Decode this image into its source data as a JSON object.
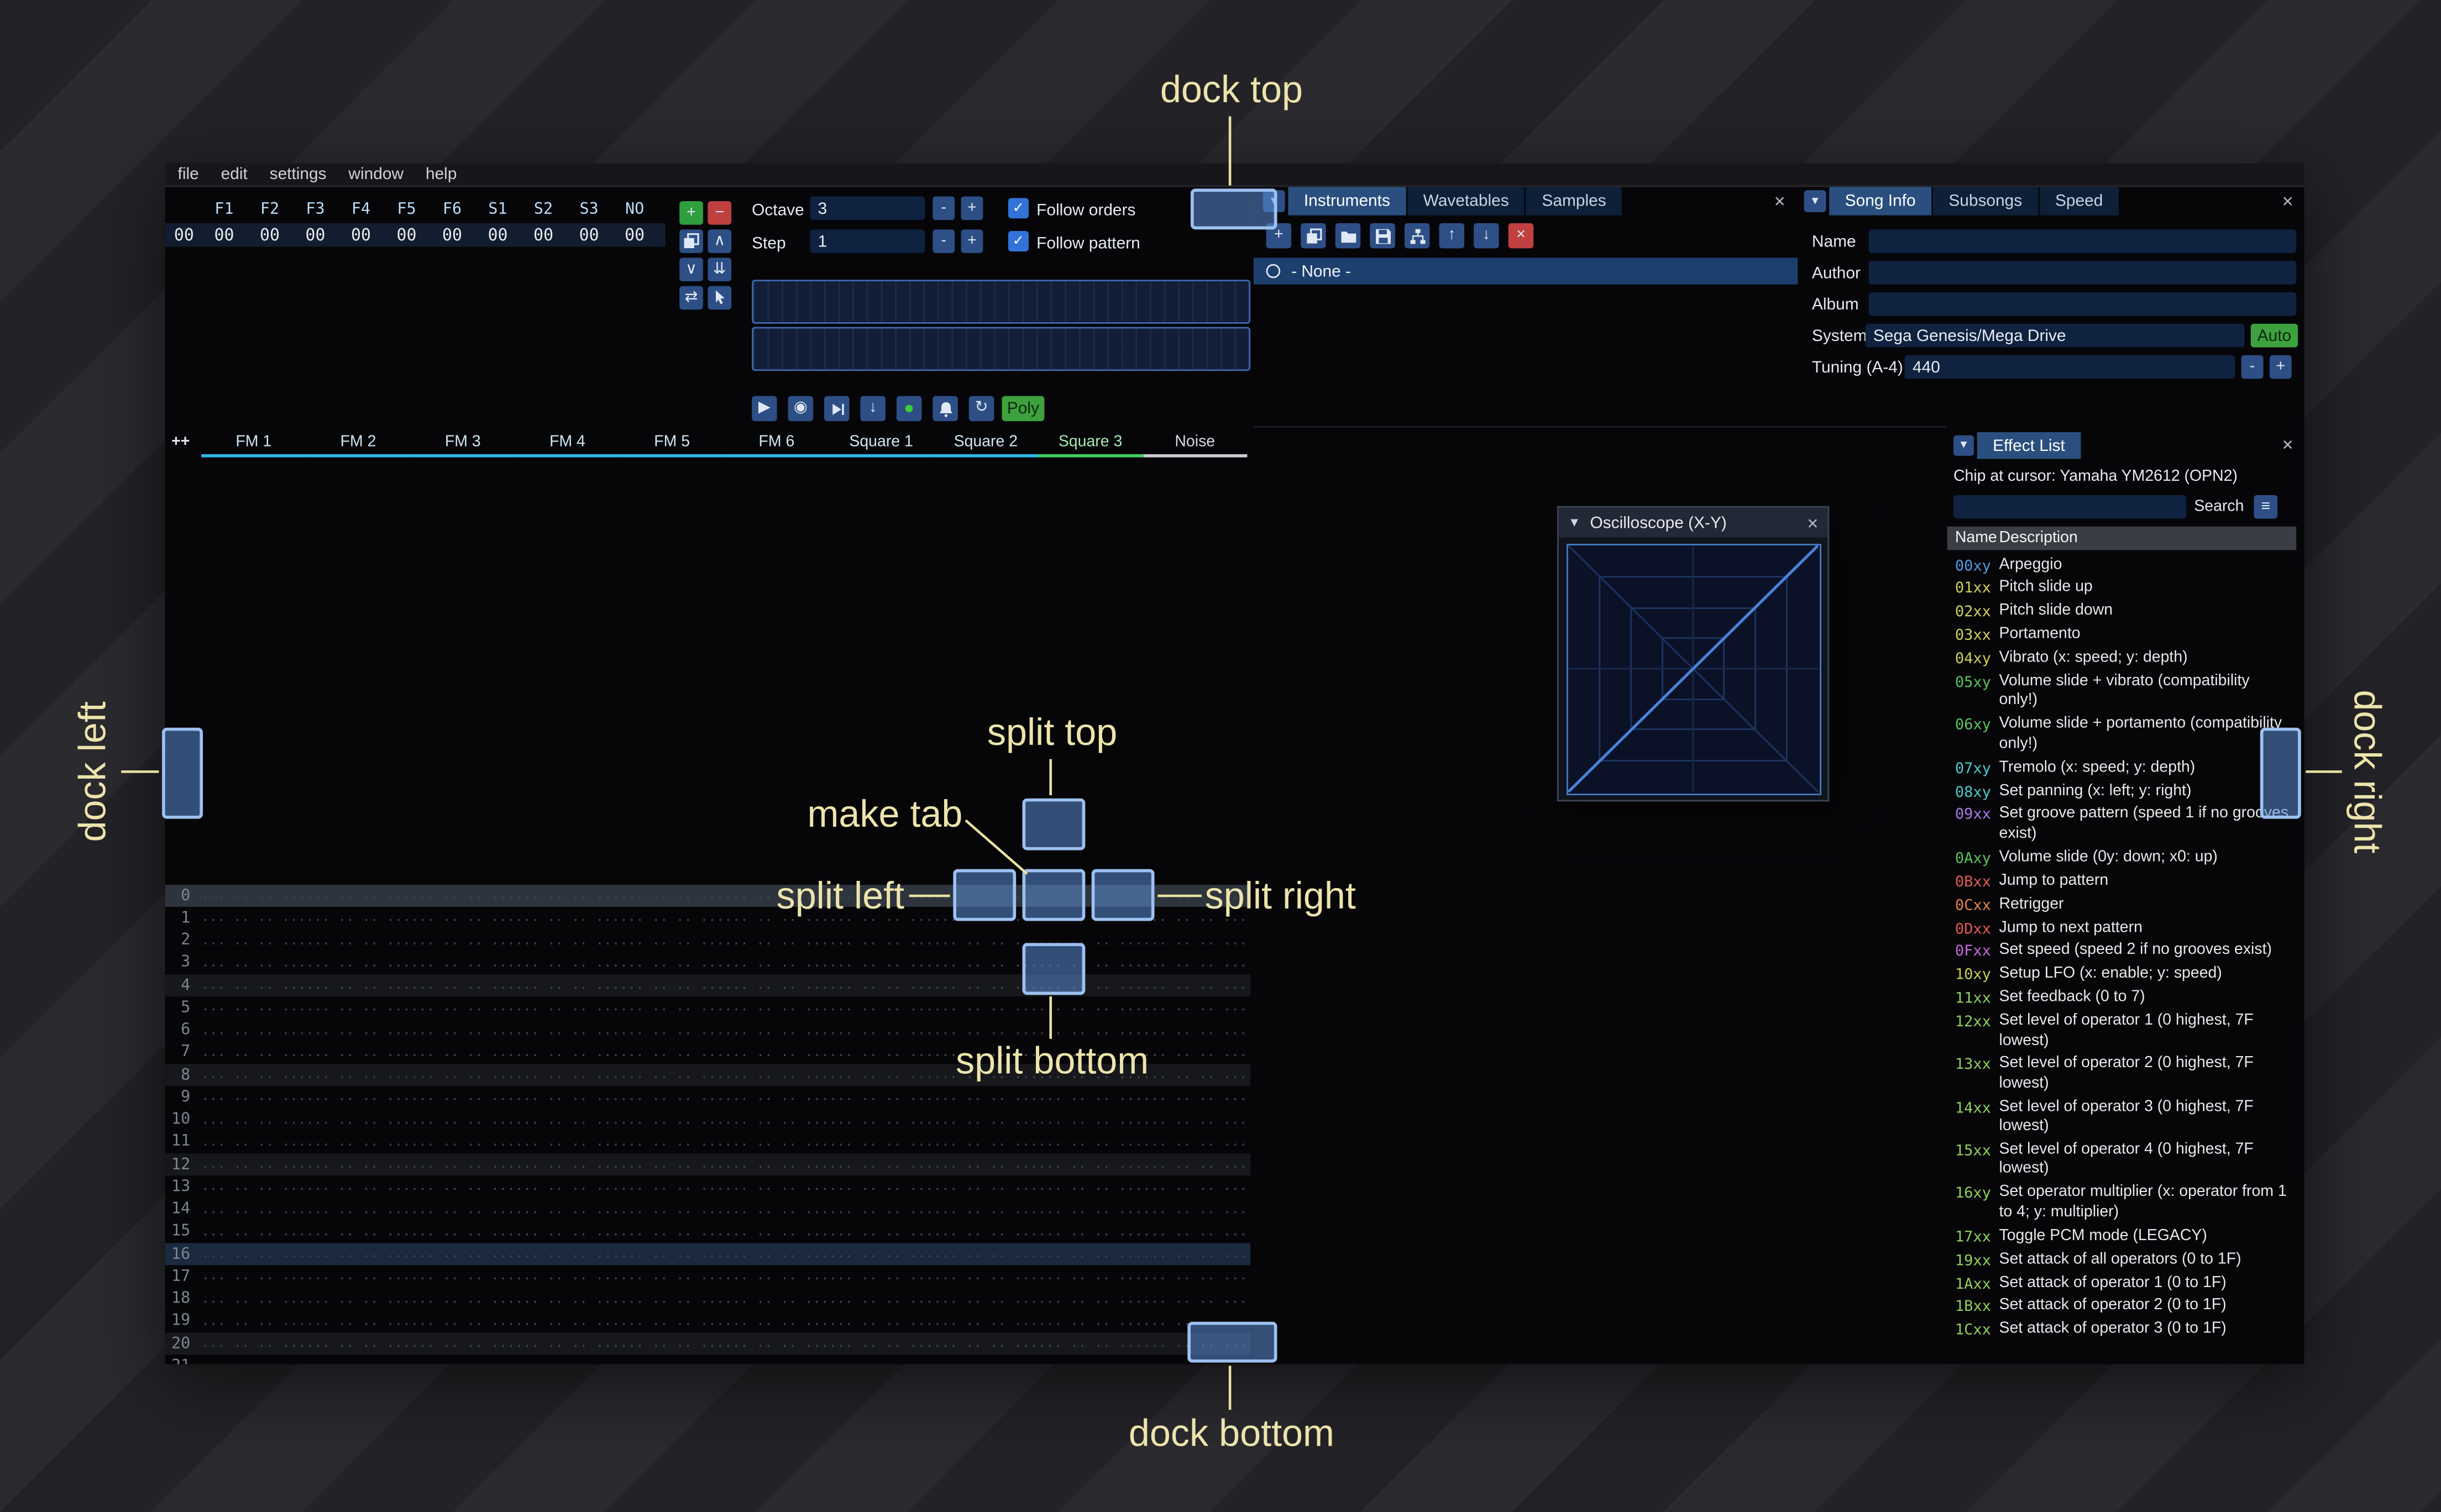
{
  "menubar": {
    "items": [
      "file",
      "edit",
      "settings",
      "window",
      "help"
    ]
  },
  "orders": {
    "header": [
      "F1",
      "F2",
      "F3",
      "F4",
      "F5",
      "F6",
      "S1",
      "S2",
      "S3",
      "NO"
    ],
    "row_index": "00",
    "row_values": [
      "00",
      "00",
      "00",
      "00",
      "00",
      "00",
      "00",
      "00",
      "00",
      "00"
    ],
    "buttons": [
      {
        "name": "order-add-button",
        "icon": "plus-icon",
        "glyph": "+",
        "style": "green"
      },
      {
        "name": "order-remove-button",
        "icon": "minus-icon",
        "glyph": "−",
        "style": "red"
      },
      {
        "name": "order-duplicate-button",
        "icon": "copy-icon",
        "glyph": ""
      },
      {
        "name": "order-move-up-button",
        "icon": "chevron-up-icon",
        "glyph": "∧"
      },
      {
        "name": "order-move-down-button",
        "icon": "chevron-down-icon",
        "glyph": "∨"
      },
      {
        "name": "order-duplicate-end-button",
        "icon": "double-down-icon",
        "glyph": "⇊"
      },
      {
        "name": "order-change-mode-button",
        "icon": "swap-icon",
        "glyph": "⇄"
      },
      {
        "name": "order-edit-click-button",
        "icon": "pointer-icon",
        "glyph": ""
      }
    ]
  },
  "play_controls": {
    "octave_label": "Octave",
    "octave_value": "3",
    "step_label": "Step",
    "step_value": "1",
    "follow_orders_label": "Follow orders",
    "follow_pattern_label": "Follow pattern",
    "minus_glyph": "-",
    "plus_glyph": "+",
    "check_glyph": "✓",
    "poly_label": "Poly",
    "buttons": [
      {
        "name": "play-button",
        "icon": "play-icon",
        "glyph": "▶"
      },
      {
        "name": "play-pattern-button",
        "icon": "circle-play-icon",
        "glyph": "◉"
      },
      {
        "name": "play-from-cursor-button",
        "icon": "play-to-cursor-icon",
        "glyph": ""
      },
      {
        "name": "step-row-button",
        "icon": "step-down-icon",
        "glyph": "↓"
      },
      {
        "name": "edit-record-button",
        "icon": "record-icon",
        "glyph": "●",
        "style": "rec"
      },
      {
        "name": "metronome-button",
        "icon": "bell-icon",
        "glyph": ""
      },
      {
        "name": "repeat-pattern-button",
        "icon": "repeat-icon",
        "glyph": "↻"
      }
    ]
  },
  "instruments": {
    "tabs": [
      "Instruments",
      "Wavetables",
      "Samples"
    ],
    "close_glyph": "×",
    "collapse_glyph": "▼",
    "toolbar": [
      {
        "name": "add-instrument-button",
        "icon": "plus-icon",
        "glyph": "+"
      },
      {
        "name": "duplicate-instrument-button",
        "icon": "copy-icon",
        "glyph": ""
      },
      {
        "name": "open-instrument-button",
        "icon": "folder-open-icon",
        "glyph": ""
      },
      {
        "name": "save-instrument-button",
        "icon": "floppy-icon",
        "glyph": ""
      },
      {
        "name": "instrument-folders-button",
        "icon": "sitemap-icon",
        "glyph": ""
      },
      {
        "name": "move-instrument-up-button",
        "icon": "arrow-up-icon",
        "glyph": "↑"
      },
      {
        "name": "move-instrument-down-button",
        "icon": "arrow-down-icon",
        "glyph": "↓"
      },
      {
        "name": "delete-instrument-button",
        "icon": "delete-icon",
        "glyph": "×",
        "style": "red"
      }
    ],
    "selected_item": "- None -"
  },
  "song_info": {
    "tabs": [
      "Song Info",
      "Subsongs",
      "Speed"
    ],
    "close_glyph": "×",
    "collapse_glyph": "▼",
    "fields": [
      {
        "label": "Name",
        "value": ""
      },
      {
        "label": "Author",
        "value": ""
      },
      {
        "label": "Album",
        "value": ""
      },
      {
        "label": "System",
        "value": "Sega Genesis/Mega Drive"
      },
      {
        "label": "Tuning (A-4)",
        "value": "440"
      }
    ],
    "auto_label": "Auto",
    "minus_glyph": "-",
    "plus_glyph": "+"
  },
  "pattern": {
    "corner_label": "++",
    "channels": [
      {
        "name": "FM 1",
        "color": "#2fb7e8",
        "text": "#cfe6f4"
      },
      {
        "name": "FM 2",
        "color": "#2fb7e8",
        "text": "#cfe6f4"
      },
      {
        "name": "FM 3",
        "color": "#2fb7e8",
        "text": "#cfe6f4"
      },
      {
        "name": "FM 4",
        "color": "#2fb7e8",
        "text": "#cfe6f4"
      },
      {
        "name": "FM 5",
        "color": "#2fb7e8",
        "text": "#cfe6f4"
      },
      {
        "name": "FM 6",
        "color": "#2fb7e8",
        "text": "#cfe6f4"
      },
      {
        "name": "Square 1",
        "color": "#2fb7e8",
        "text": "#cfe6f4"
      },
      {
        "name": "Square 2",
        "color": "#2fb7e8",
        "text": "#cfe6f4"
      },
      {
        "name": "Square 3",
        "color": "#41cf5f",
        "text": "#a6e8b0"
      },
      {
        "name": "Noise",
        "color": "#c9ced2",
        "text": "#d7dbdf"
      }
    ],
    "row_count": 22,
    "current_row": 0,
    "empty_cell": "... .. .. ..."
  },
  "oscilloscope": {
    "title": "Oscilloscope (X-Y)",
    "collapse_glyph": "▼",
    "close_glyph": "×"
  },
  "effect_list": {
    "title": "Effect List",
    "collapse_glyph": "▼",
    "close_glyph": "×",
    "chip_line": "Chip at cursor: Yamaha YM2612 (OPN2)",
    "search_label": "Search",
    "menu_glyph": "≡",
    "columns": [
      "Name",
      "Description"
    ],
    "effects": [
      {
        "code": "00xy",
        "desc": "Arpeggio",
        "color": "#4f9be2"
      },
      {
        "code": "01xx",
        "desc": "Pitch slide up",
        "color": "#cfd25a"
      },
      {
        "code": "02xx",
        "desc": "Pitch slide down",
        "color": "#cfd25a"
      },
      {
        "code": "03xx",
        "desc": "Portamento",
        "color": "#cfd25a"
      },
      {
        "code": "04xy",
        "desc": "Vibrato (x: speed; y: depth)",
        "color": "#cfd25a"
      },
      {
        "code": "05xy",
        "desc": "Volume slide + vibrato (compatibility only!)",
        "color": "#57c45c"
      },
      {
        "code": "06xy",
        "desc": "Volume slide + portamento (compatibility only!)",
        "color": "#57c45c"
      },
      {
        "code": "07xy",
        "desc": "Tremolo (x: speed; y: depth)",
        "color": "#4ecaca"
      },
      {
        "code": "08xy",
        "desc": "Set panning (x: left; y: right)",
        "color": "#4ecaca"
      },
      {
        "code": "09xx",
        "desc": "Set groove pattern (speed 1 if no grooves exist)",
        "color": "#a879e6"
      },
      {
        "code": "0Axy",
        "desc": "Volume slide (0y: down; x0: up)",
        "color": "#57c45c"
      },
      {
        "code": "0Bxx",
        "desc": "Jump to pattern",
        "color": "#e25b52"
      },
      {
        "code": "0Cxx",
        "desc": "Retrigger",
        "color": "#e28448"
      },
      {
        "code": "0Dxx",
        "desc": "Jump to next pattern",
        "color": "#e25b52"
      },
      {
        "code": "0Fxx",
        "desc": "Set speed (speed 2 if no grooves exist)",
        "color": "#c76ad8"
      },
      {
        "code": "10xy",
        "desc": "Setup LFO (x: enable; y: speed)",
        "color": "#c6cf52"
      },
      {
        "code": "11xx",
        "desc": "Set feedback (0 to 7)",
        "color": "#8fd05a"
      },
      {
        "code": "12xx",
        "desc": "Set level of operator 1 (0 highest, 7F lowest)",
        "color": "#8fd05a"
      },
      {
        "code": "13xx",
        "desc": "Set level of operator 2 (0 highest, 7F lowest)",
        "color": "#8fd05a"
      },
      {
        "code": "14xx",
        "desc": "Set level of operator 3 (0 highest, 7F lowest)",
        "color": "#8fd05a"
      },
      {
        "code": "15xx",
        "desc": "Set level of operator 4 (0 highest, 7F lowest)",
        "color": "#8fd05a"
      },
      {
        "code": "16xy",
        "desc": "Set operator multiplier (x: operator from 1 to 4; y: multiplier)",
        "color": "#8fd05a"
      },
      {
        "code": "17xx",
        "desc": "Toggle PCM mode (LEGACY)",
        "color": "#8fd05a"
      },
      {
        "code": "19xx",
        "desc": "Set attack of all operators (0 to 1F)",
        "color": "#8fd05a"
      },
      {
        "code": "1Axx",
        "desc": "Set attack of operator 1 (0 to 1F)",
        "color": "#8fd05a"
      },
      {
        "code": "1Bxx",
        "desc": "Set attack of operator 2 (0 to 1F)",
        "color": "#8fd05a"
      },
      {
        "code": "1Cxx",
        "desc": "Set attack of operator 3 (0 to 1F)",
        "color": "#8fd05a"
      }
    ]
  },
  "overlay": {
    "labels": {
      "dock_top": "dock top",
      "dock_bottom": "dock bottom",
      "dock_left": "dock left",
      "dock_right": "dock right",
      "split_top": "split top",
      "split_bottom": "split bottom",
      "split_left": "split left",
      "split_right": "split right",
      "make_tab": "make tab"
    },
    "colors": {
      "indicator_fill": "#5a8cd2",
      "indicator_border": "#9cc0f0",
      "label": "#ece4ab",
      "line": "#e9e0a2"
    }
  }
}
